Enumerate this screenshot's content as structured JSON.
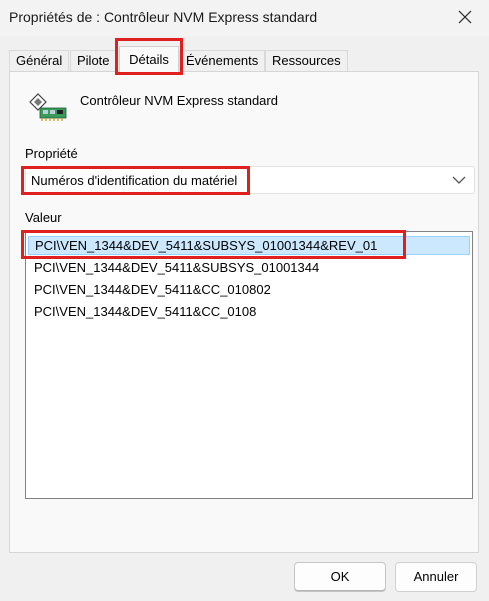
{
  "window": {
    "title": "Propriétés de : Contrôleur NVM Express standard",
    "close_icon": "close-icon"
  },
  "tabs": [
    {
      "label": "Général"
    },
    {
      "label": "Pilote"
    },
    {
      "label": "Détails",
      "active": true
    },
    {
      "label": "Événements"
    },
    {
      "label": "Ressources"
    }
  ],
  "device": {
    "icon": "storage-controller-icon",
    "name": "Contrôleur NVM Express standard"
  },
  "property": {
    "label": "Propriété",
    "selected": "Numéros d'identification du matériel"
  },
  "value": {
    "label": "Valeur",
    "items": [
      "PCI\\VEN_1344&DEV_5411&SUBSYS_01001344&REV_01",
      "PCI\\VEN_1344&DEV_5411&SUBSYS_01001344",
      "PCI\\VEN_1344&DEV_5411&CC_010802",
      "PCI\\VEN_1344&DEV_5411&CC_0108"
    ],
    "selected_index": 0
  },
  "buttons": {
    "ok": "OK",
    "cancel": "Annuler"
  },
  "colors": {
    "highlight": "#e0201f",
    "selection": "#cce8ff"
  }
}
